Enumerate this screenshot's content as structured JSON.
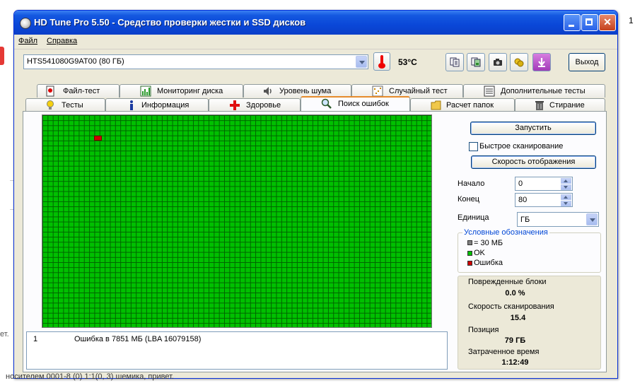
{
  "window": {
    "title": "HD Tune Pro 5.50 - Средство проверки жестки и SSD дисков"
  },
  "menu": {
    "file": "Файл",
    "help": "Справка"
  },
  "toolbar": {
    "drive": "HTS541080G9AT00 (80 ГБ)",
    "temperature": "53°C",
    "exit_label": "Выход",
    "icons": [
      "copy-text-icon",
      "copy-screenshot-icon",
      "camera-icon",
      "options-icon",
      "save-icon"
    ]
  },
  "tabs": {
    "row1": [
      "Файл-тест",
      "Мониторинг диска",
      "Уровень шума",
      "Случайный тест",
      "Дополнительные тесты"
    ],
    "row2": [
      "Тесты",
      "Информация",
      "Здоровье",
      "Поиск ошибок",
      "Расчет папок",
      "Стирание"
    ],
    "active": "Поиск ошибок"
  },
  "scan": {
    "start_label": "Запустить",
    "quick_scan_label": "Быстрое сканирование",
    "quick_scan_checked": false,
    "speed_label": "Скорость отображения",
    "start_pos_label": "Начало",
    "start_pos_value": "0",
    "end_pos_label": "Конец",
    "end_pos_value": "80",
    "unit_label": "Единица",
    "unit_value": "ГБ"
  },
  "grid": {
    "columns": 75,
    "rows": 42,
    "error_cells": [
      {
        "col": 10,
        "row": 4
      }
    ],
    "ok_color": "#00c000",
    "error_color": "#d00000"
  },
  "legend": {
    "title": "Условные обозначения",
    "items": [
      {
        "label": "= 30 МБ",
        "color": "#808080"
      },
      {
        "label": "OK",
        "color": "#00c000"
      },
      {
        "label": "Ошибка",
        "color": "#d00000"
      }
    ]
  },
  "stats": {
    "damaged_label": "Поврежденные блоки",
    "damaged_value": "0.0 %",
    "speed_label": "Скорость сканирования",
    "speed_value": "15.4",
    "position_label": "Позиция",
    "position_value": "79 ГБ",
    "elapsed_label": "Затраченное время",
    "elapsed_value": "1:12:49"
  },
  "log": [
    {
      "index": "1",
      "message": "Ошибка в 7851 МБ (LBA 16079158)"
    }
  ],
  "background": {
    "right_top": "1",
    "left_mid": "ет.",
    "bottom_line": "носителем 0001-8 (0) 1:1(0, 3) шемика, привет."
  }
}
